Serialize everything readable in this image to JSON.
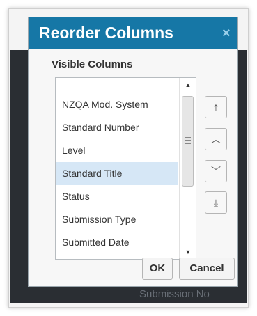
{
  "dialog": {
    "title": "Reorder Columns",
    "close_glyph": "×",
    "section_label": "Visible Columns",
    "columns": [
      "NZQA Mod. System",
      "Standard Number",
      "Level",
      "Standard Title",
      "Status",
      "Submission Type",
      "Submitted Date"
    ],
    "selected_index": 3,
    "move_buttons": {
      "top": "⤒",
      "up": "︿",
      "down": "﹀",
      "bottom": "⤓"
    },
    "scrollbar": {
      "up": "▲",
      "down": "▼"
    },
    "ok_label": "OK",
    "cancel_label": "Cancel"
  },
  "background": {
    "bottom_text": "Submission   No"
  },
  "colors": {
    "titlebar": "#1677a6",
    "selected_row": "#d6e7f6"
  }
}
